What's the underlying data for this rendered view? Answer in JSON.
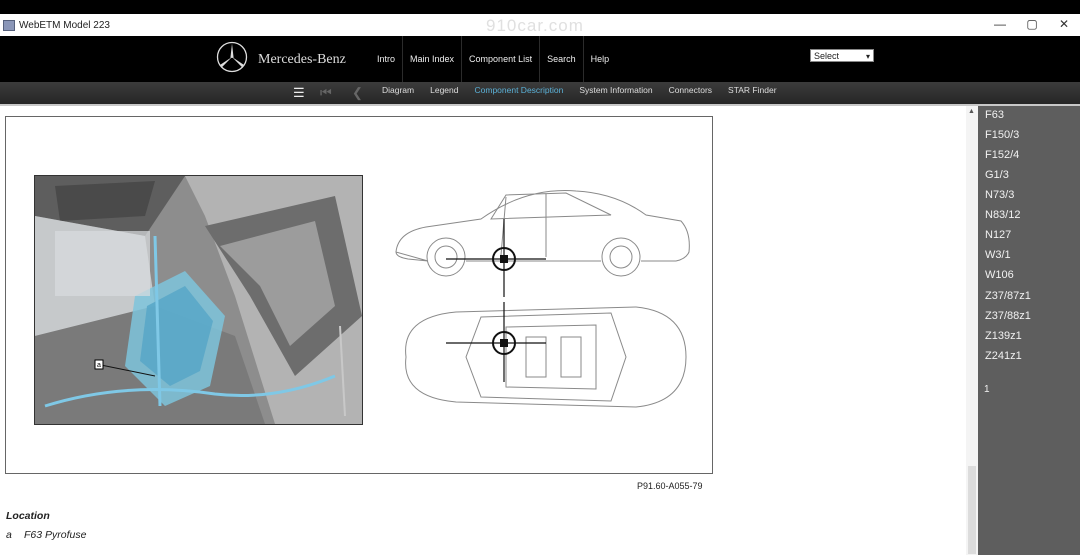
{
  "window": {
    "title": "WebETM Model 223",
    "watermark": "910car.com",
    "controls": {
      "minimize": "—",
      "maximize": "▢",
      "close": "✕"
    }
  },
  "header": {
    "brand": "Mercedes-Benz",
    "nav": [
      "Intro",
      "Main Index",
      "Component List",
      "Search",
      "Help"
    ],
    "select": {
      "value": "Select"
    }
  },
  "subnav": {
    "icons": [
      "menu-icon",
      "first-page-icon",
      "back-icon"
    ],
    "links": [
      "Diagram",
      "Legend",
      "Component Description",
      "System Information",
      "Connectors",
      "STAR Finder"
    ],
    "active": "Component Description"
  },
  "figure": {
    "code": "P91.60-A055-79",
    "photo_marker": "a"
  },
  "location": {
    "heading": "Location",
    "item_letter": "a",
    "item_text": "F63 Pyrofuse"
  },
  "sidebar": {
    "components": [
      "F63",
      "F150/3",
      "F152/4",
      "G1/3",
      "N73/3",
      "N83/12",
      "N127",
      "W3/1",
      "W106",
      "Z37/87z1",
      "Z37/88z1",
      "Z139z1",
      "Z241z1"
    ],
    "page": "1"
  }
}
